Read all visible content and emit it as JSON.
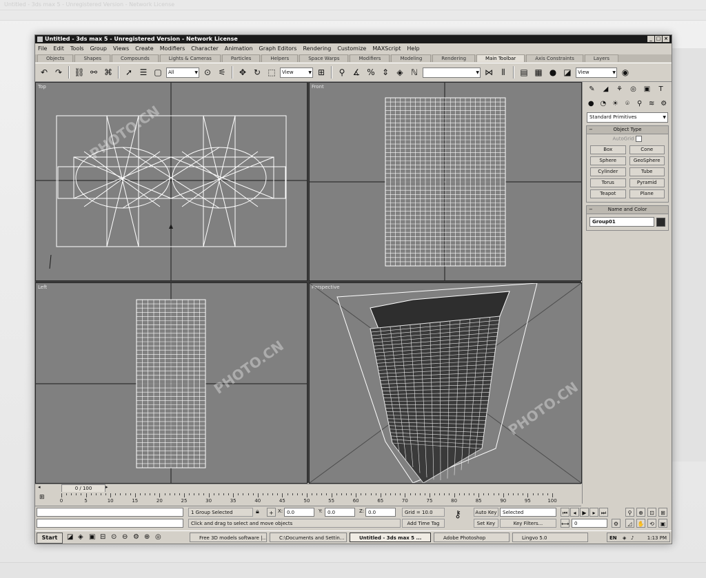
{
  "window": {
    "title": "Untitled - 3ds max 5 - Unregistered Version - Network License",
    "controls": [
      "_",
      "□",
      "×"
    ]
  },
  "menu": [
    "File",
    "Edit",
    "Tools",
    "Group",
    "Views",
    "Create",
    "Modifiers",
    "Character",
    "Animation",
    "Graph Editors",
    "Rendering",
    "Customize",
    "MAXScript",
    "Help"
  ],
  "tabs": [
    {
      "label": "Objects",
      "active": false
    },
    {
      "label": "Shapes",
      "active": false
    },
    {
      "label": "Compounds",
      "active": false
    },
    {
      "label": "Lights & Cameras",
      "active": false
    },
    {
      "label": "Particles",
      "active": false
    },
    {
      "label": "Helpers",
      "active": false
    },
    {
      "label": "Space Warps",
      "active": false
    },
    {
      "label": "Modifiers",
      "active": false
    },
    {
      "label": "Modeling",
      "active": false
    },
    {
      "label": "Rendering",
      "active": false
    },
    {
      "label": "Main Toolbar",
      "active": true
    },
    {
      "label": "Axis Constraints",
      "active": false
    },
    {
      "label": "Layers",
      "active": false
    }
  ],
  "toolbar": {
    "selection_filter": "All",
    "ref_coord": "View",
    "render_view": "View"
  },
  "viewports": {
    "top": "Top",
    "front": "Front",
    "left": "Left",
    "perspective": "Perspective"
  },
  "command_panel": {
    "category_dropdown": "Standard Primitives",
    "object_type_header": "Object Type",
    "autogrid_label": "AutoGrid",
    "buttons": [
      "Box",
      "Cone",
      "Sphere",
      "GeoSphere",
      "Cylinder",
      "Tube",
      "Torus",
      "Pyramid",
      "Teapot",
      "Plane"
    ],
    "name_color_header": "Name and Color",
    "object_name": "Group01",
    "object_color": "#2a2a2a"
  },
  "timeline": {
    "slider_label": "0 / 100",
    "ticks": [
      "0",
      "5",
      "10",
      "15",
      "20",
      "25",
      "30",
      "35",
      "40",
      "45",
      "50",
      "55",
      "60",
      "65",
      "70",
      "75",
      "80",
      "85",
      "90",
      "95",
      "100"
    ]
  },
  "status": {
    "selection_count": "1 Group Selected",
    "prompt": "Click and drag to select and move objects",
    "x_label": "X:",
    "x_value": "0.0",
    "y_label": "Y:",
    "y_value": "0.0",
    "z_label": "Z:",
    "z_value": "0.0",
    "grid": "Grid = 10.0",
    "add_time_tag": "Add Time Tag",
    "auto_key": "Auto Key",
    "set_key": "Set Key",
    "key_mode": "Selected",
    "key_filters": "Key Filters...",
    "frame": "0"
  },
  "taskbar": {
    "start": "Start",
    "items": [
      {
        "label": "Free 3D models software |...",
        "active": false
      },
      {
        "label": "C:\\Documents and Settin...",
        "active": false
      },
      {
        "label": "Untitled - 3ds max 5 ...",
        "active": true
      },
      {
        "label": "Adobe Photoshop",
        "active": false
      },
      {
        "label": "Lingvo 5.0",
        "active": false
      }
    ],
    "lang": "EN",
    "clock": "1:13 PM"
  },
  "ghost": {
    "title": "Untitled - 3ds max 5 - Unregistered Version - Network License"
  },
  "colors": {
    "viewport_bg": "#808080",
    "wire": "#ffffff",
    "ui_face": "#d4d0c8",
    "titlebar": "#1a1a1a"
  }
}
